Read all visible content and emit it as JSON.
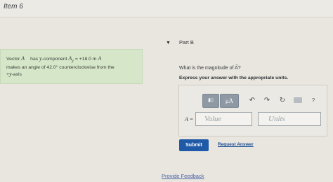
{
  "header": {
    "item_title": "Item 6"
  },
  "problem": {
    "line1_pre": "Vector",
    "vec_symbol": "A⃗",
    "line1_mid": "has",
    "y_var": "y",
    "line1_comp": "-component",
    "ay_symbol": "A",
    "ay_sub": "y",
    "line1_eq": " = +18.0 m ",
    "line1_end": "A⃗",
    "line2": "makes an angle of 42.0° counterclockwise from the",
    "line3_prefix": "+",
    "line3_var": "y",
    "line3_suffix": "-axis"
  },
  "part_b": {
    "chevron": "▼",
    "label": "Part B",
    "question": "What is the magnitude of A⃗?",
    "instruction": "Express your answer with the appropriate units."
  },
  "toolbar": {
    "template_icon": "▮▯",
    "mu_label": "μA",
    "undo_icon": "↶",
    "redo_icon": "↷",
    "reset_icon": "↻",
    "help_icon": "?"
  },
  "answer": {
    "var_label": "A =",
    "value_placeholder": "Value",
    "units_placeholder": "Units"
  },
  "actions": {
    "submit_label": "Submit",
    "request_answer_label": "Request Answer",
    "feedback_label": "Provide Feedback"
  },
  "colors": {
    "problem_bg": "#d6e6c8",
    "submit_bg": "#1e5aa7",
    "link": "#1a4c94"
  }
}
